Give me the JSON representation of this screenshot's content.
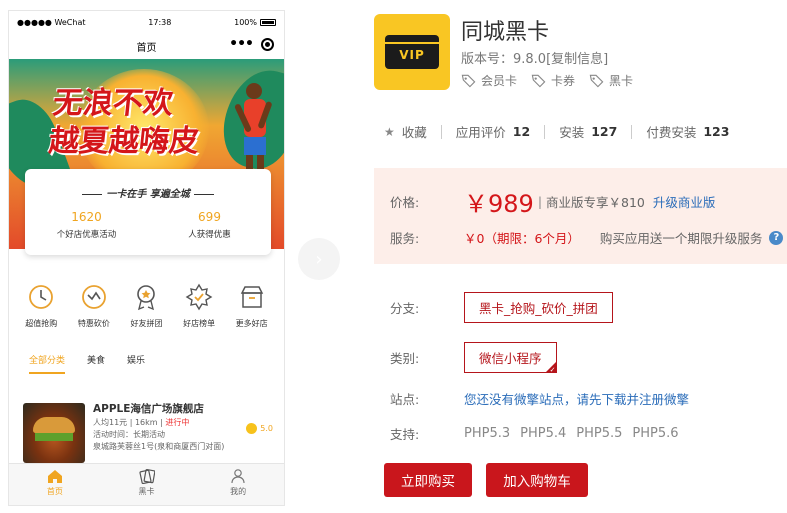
{
  "phone": {
    "status": {
      "carrier": "●●●●● WeChat",
      "time": "17:38",
      "battery": "100%"
    },
    "nav_title": "首页",
    "banner": {
      "headline_line1": "无浪不欢",
      "headline_line2": "越夏越嗨皮",
      "slogan": "一卡在手 享遍全城",
      "stats": [
        {
          "value": "1620",
          "label": "个好店优惠活动"
        },
        {
          "value": "699",
          "label": "人获得优惠"
        }
      ]
    },
    "features": [
      {
        "icon": "clock-icon",
        "label": "超值抢购"
      },
      {
        "icon": "discount-icon",
        "label": "特惠砍价"
      },
      {
        "icon": "badge-icon",
        "label": "好友拼团"
      },
      {
        "icon": "star-burst-icon",
        "label": "好店榜单"
      },
      {
        "icon": "shop-icon",
        "label": "更多好店"
      }
    ],
    "tabs": [
      "全部分类",
      "美食",
      "娱乐"
    ],
    "store": {
      "name": "APPLE海信广场旗舰店",
      "meta_prefix": "人均11元 | 16km | ",
      "status": "进行中",
      "activity": "活动时间：长期活动",
      "address": "泉城路芙蓉丝1号(泉和商厦西门对面)",
      "rating": "5.0"
    },
    "tabbar": [
      {
        "icon": "home-icon",
        "label": "首页"
      },
      {
        "icon": "card-icon",
        "label": "黑卡"
      },
      {
        "icon": "user-icon",
        "label": "我的"
      }
    ]
  },
  "app": {
    "icon_text": "VIP",
    "name": "同城黑卡",
    "version": "版本号：9.8.0",
    "copy_info": "[复制信息]",
    "tags": [
      "会员卡",
      "卡券",
      "黑卡"
    ],
    "favorite_label": "收藏",
    "rating_label": "应用评价",
    "rating_count": "12",
    "install_label": "安装",
    "install_count": "127",
    "paid_install_label": "付费安装",
    "paid_install_count": "123"
  },
  "pricing": {
    "price_label": "价格:",
    "price": "￥989",
    "pipe": "|",
    "business_text": "商业版专享￥810",
    "upgrade_link": "升级商业版",
    "service_label": "服务:",
    "service_value": "￥0（期限：6个月）",
    "service_note": "购买应用送一个期限升级服务",
    "help_icon": "?"
  },
  "options": {
    "branch_label": "分支:",
    "branch_value": "黑卡_抢购_砍价_拼团",
    "category_label": "类别:",
    "category_value": "微信小程序",
    "site_label": "站点:",
    "site_text": "您还没有微擎站点，请先下载并注册微擎",
    "support_label": "支持:",
    "support_versions": [
      "PHP5.3",
      "PHP5.4",
      "PHP5.5",
      "PHP5.6"
    ]
  },
  "actions": {
    "buy_label": "立即购买",
    "cart_label": "加入购物车"
  },
  "colors": {
    "accent_red": "#c9161c",
    "price_red": "#d4161a",
    "link_blue": "#2a6cb9",
    "brand_yellow": "#f9c623",
    "phone_accent": "#f0a520",
    "price_bg": "#fdeee9"
  }
}
